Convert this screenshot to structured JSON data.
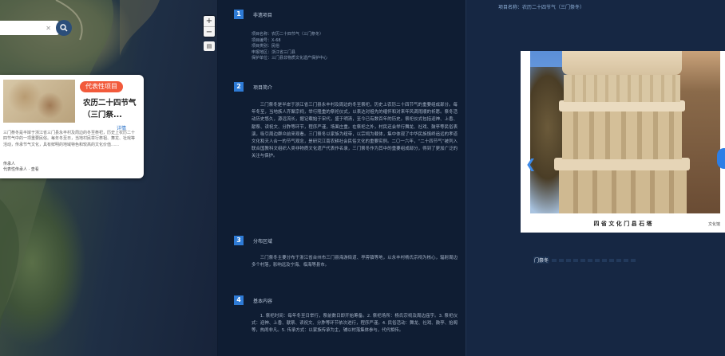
{
  "map": {
    "search": {
      "placeholder": "",
      "clear_icon": "✕",
      "search_icon": "search-icon"
    },
    "zoom": {
      "in": "+",
      "out": "−"
    },
    "layer_btn": "▤",
    "popup": {
      "badge": "代表性项目",
      "title": "农历二十四节气（三门祭...",
      "detail_link": "详情",
      "desc": "三门祭冬是半岸于浙江省三门县永丰村及周边的冬至祭祀，历史上农历二十四节气中的一项重要民俗。每年冬至日，当地村民举行祭祖、舞龙、社戏等活动，传承节气文化，具有鲜明的地域特色和较高的文化价值……",
      "meta": [
        "传承人",
        "代表性传承人 · 查看"
      ]
    }
  },
  "article": {
    "sections": [
      {
        "num": "1",
        "title": "非遗项目"
      },
      {
        "num": "2",
        "title": "项目简介"
      },
      {
        "num": "3",
        "title": "分布区域"
      },
      {
        "num": "4",
        "title": "基本内容"
      }
    ],
    "info": [
      "项目名称：农历二十四节气（三门祭冬）",
      "项目编号：Ⅹ-68",
      "项目类别：民俗",
      "申报地区：浙江省三门县",
      "保护单位：三门县非物质文化遗产保护中心"
    ],
    "intro": "三门祭冬是半岸于浙江省三门县永丰村及周边的冬至祭祀，历史上农历二十四节气的重要组成部分。每年冬至，当地族人齐聚宗祠，举行隆重的祭祀仪式，以表达对祖先的缅怀和对来年风调雨顺的祈愿。祭冬活动历史悠久，源远流长，据记载始于宋代，盛于明清，至今已有数百年的历史。祭祀仪式包括迎神、上香、献祭、读祝文、分胙等环节，程序严谨，场面庄重。在祭祀之外，村民还会举行舞龙、社戏、鼓亭等民俗表演，吸引周边群众前来观看。三门祭冬以家族为纽带，以宗祠为载体，集中体现了中华民族慎终追远的孝道文化和天人合一的节气观念，是研究江南农耕社会民俗文化的重要实例。二〇一六年，“二十四节气”被列入联合国教科文组织人类非物质文化遗产代表作名录，三门祭冬作为其中的重要组成部分，得到了更加广泛的关注与保护。",
    "distribution": "三门祭冬主要分布于浙江省台州市三门县海游街道、亭旁镇等地，以永丰村杨氏宗祠为核心，辐射周边多个村落，影响远及宁海、临海等县市。",
    "content": "1. 祭祀时间：每年冬至日举行，祭前数日即开始筹备。2. 祭祀场所：杨氏宗祠及周边庙宇。3. 祭祀仪式：迎神、上香、献祭、读祝文、分胙等环节依次进行，程序严谨。4. 民俗活动：舞龙、社戏、鼓亭、抬阁等，热闹非凡。5. 传承方式：以家族传承为主，辅以村落集体参与，代代相传。"
  },
  "right": {
    "project_name": "项目名称：农历二十四节气（三门祭冬）",
    "caption_main": "四 省 文 化  门 县 石 塔",
    "caption_side": "文化馆",
    "thumb_label": "门祭冬",
    "dots": 12
  }
}
